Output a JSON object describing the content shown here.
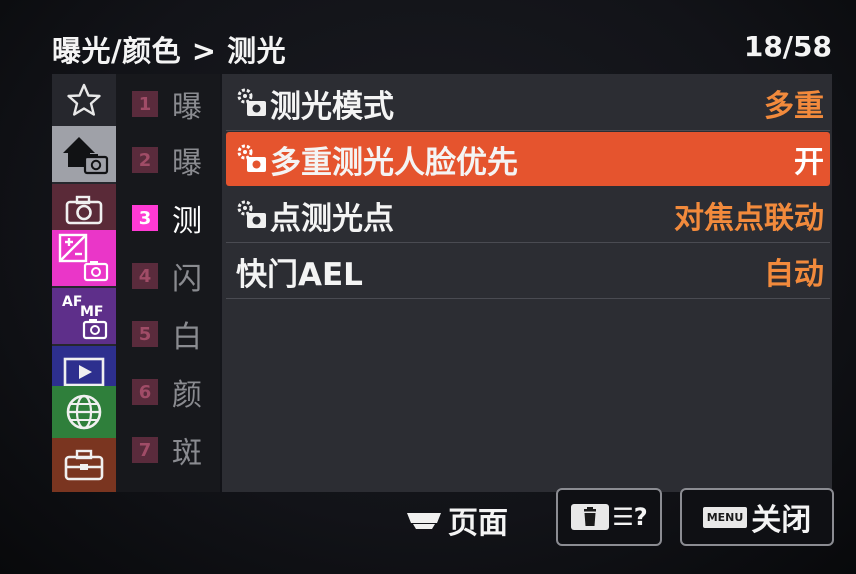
{
  "header": {
    "breadcrumb": "曝光/颜色 > 测光",
    "page_count": "18/58"
  },
  "categories": [
    {
      "name": "favorites",
      "icon": "star-outline-icon"
    },
    {
      "name": "home-shooting",
      "icon": "home-camera-icon",
      "selected": true
    },
    {
      "name": "shooting",
      "icon": "camera-icon"
    },
    {
      "name": "exposure-color",
      "icon": "exposure-camera-icon",
      "active": true
    },
    {
      "name": "af-mf",
      "icon": "af-mf-camera-icon",
      "text": "AF MF"
    },
    {
      "name": "playback",
      "icon": "playback-icon"
    },
    {
      "name": "network",
      "icon": "globe-icon"
    },
    {
      "name": "setup",
      "icon": "toolbox-icon"
    }
  ],
  "pages": [
    {
      "num": "1",
      "label": "曝"
    },
    {
      "num": "2",
      "label": "曝"
    },
    {
      "num": "3",
      "label": "测",
      "active": true
    },
    {
      "num": "4",
      "label": "闪"
    },
    {
      "num": "5",
      "label": "白"
    },
    {
      "num": "6",
      "label": "颜"
    },
    {
      "num": "7",
      "label": "斑"
    }
  ],
  "menu_items": [
    {
      "label": "测光模式",
      "value": "多重",
      "icon": "photo-settings-icon"
    },
    {
      "label": "多重测光人脸优先",
      "value": "开",
      "icon": "photo-settings-icon",
      "selected": true
    },
    {
      "label": "点测光点",
      "value": "对焦点联动",
      "icon": "photo-settings-icon"
    },
    {
      "label": "快门AEL",
      "value": "自动"
    }
  ],
  "footer": {
    "page_label": "页面",
    "delete_glyph": "☰?",
    "menu_badge": "MENU",
    "close_label": "关闭"
  },
  "colors": {
    "selected_row": "#e5542e",
    "value_text": "#f28a3c",
    "active_page": "#ff3ad4"
  }
}
